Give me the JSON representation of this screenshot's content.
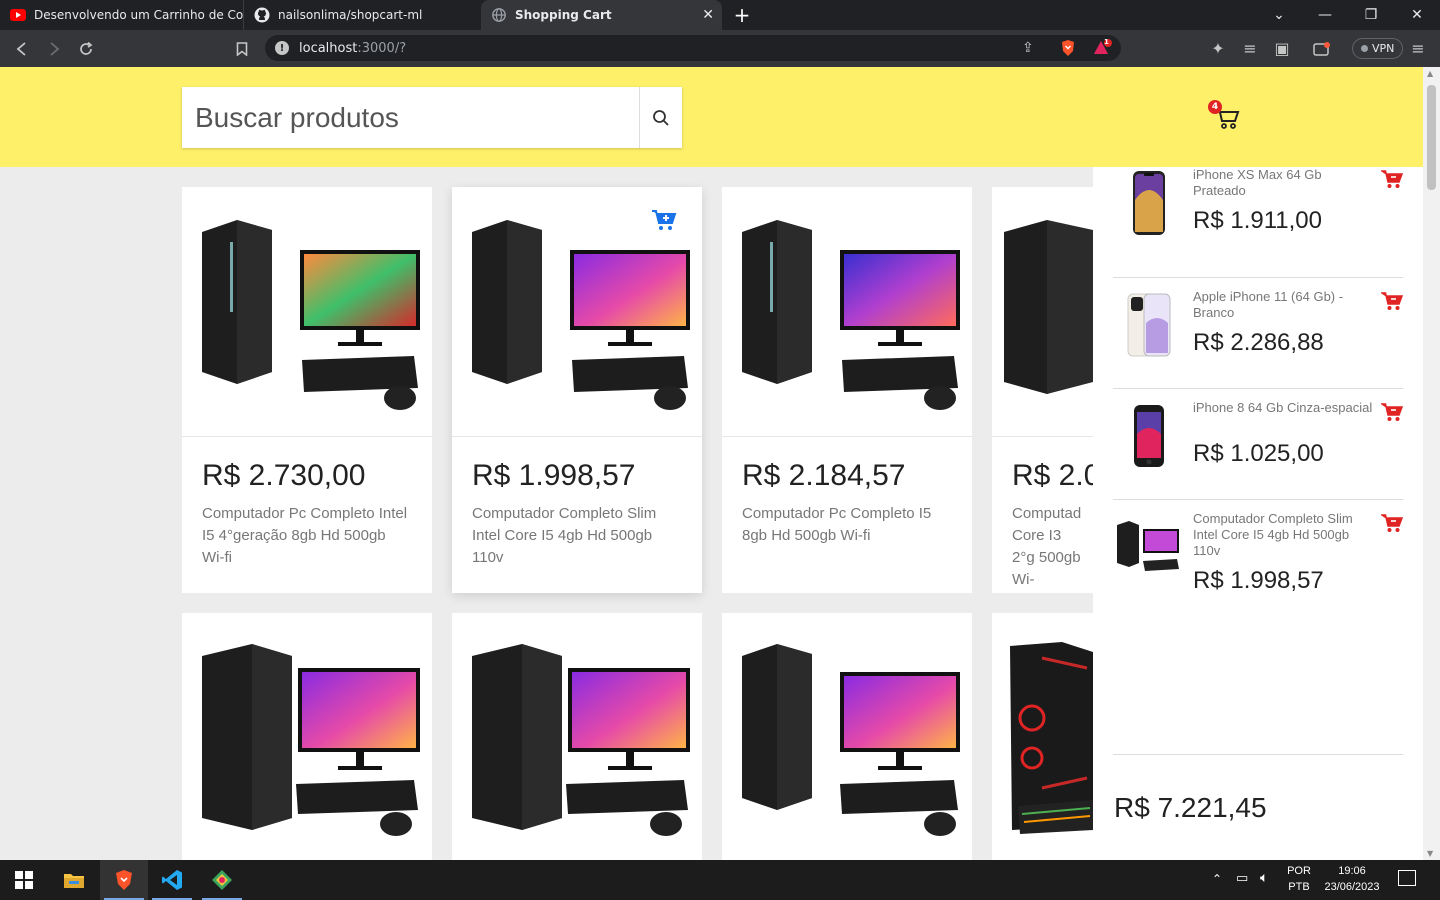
{
  "browser": {
    "tabs": [
      {
        "title": "Desenvolvendo um Carrinho de Comp",
        "icon": "youtube-icon"
      },
      {
        "title": "nailsonlima/shopcart-ml",
        "icon": "github-icon"
      },
      {
        "title": "Shopping Cart",
        "icon": "globe-icon",
        "active": true
      }
    ],
    "url_host": "localhost",
    "url_rest": ":3000/?",
    "vpn_label": "VPN",
    "brave_badge": "1"
  },
  "header": {
    "search_placeholder": "Buscar produtos",
    "cart_count": "4"
  },
  "products": [
    {
      "price": "R$ 2.730,00",
      "title": "Computador Pc Completo Intel I5 4°geração 8gb Hd 500gb Wi-fi"
    },
    {
      "price": "R$ 1.998,57",
      "title": "Computador Completo Slim Intel Core I5 4gb Hd 500gb 110v"
    },
    {
      "price": "R$ 2.184,57",
      "title": "Computador Pc Completo I5 8gb Hd 500gb Wi-fi"
    },
    {
      "price": "R$ 2.0",
      "title": "Computad Core I3 2°g 500gb Wi-"
    }
  ],
  "cart": {
    "items": [
      {
        "title": "iPhone XS Max 64 Gb Prateado",
        "price": "R$ 1.911,00",
        "thumb": "iphone-xs-icon"
      },
      {
        "title": "Apple iPhone 11 (64 Gb) - Branco",
        "price": "R$ 2.286,88",
        "thumb": "iphone-11-icon"
      },
      {
        "title": "iPhone 8 64 Gb Cinza-espacial",
        "price": "R$ 1.025,00",
        "thumb": "iphone-8-icon"
      },
      {
        "title": "Computador Completo Slim Intel Core I5 4gb Hd 500gb 110v",
        "price": "R$ 1.998,57",
        "thumb": "computer-icon"
      }
    ],
    "total": "R$ 7.221,45"
  },
  "taskbar": {
    "lang_top": "POR",
    "lang_bottom": "PTB",
    "time": "19:06",
    "date": "23/06/2023"
  },
  "colors": {
    "header_bg": "#fff06a",
    "accent_blue": "#1a73e8",
    "remove_red": "#e02424"
  }
}
